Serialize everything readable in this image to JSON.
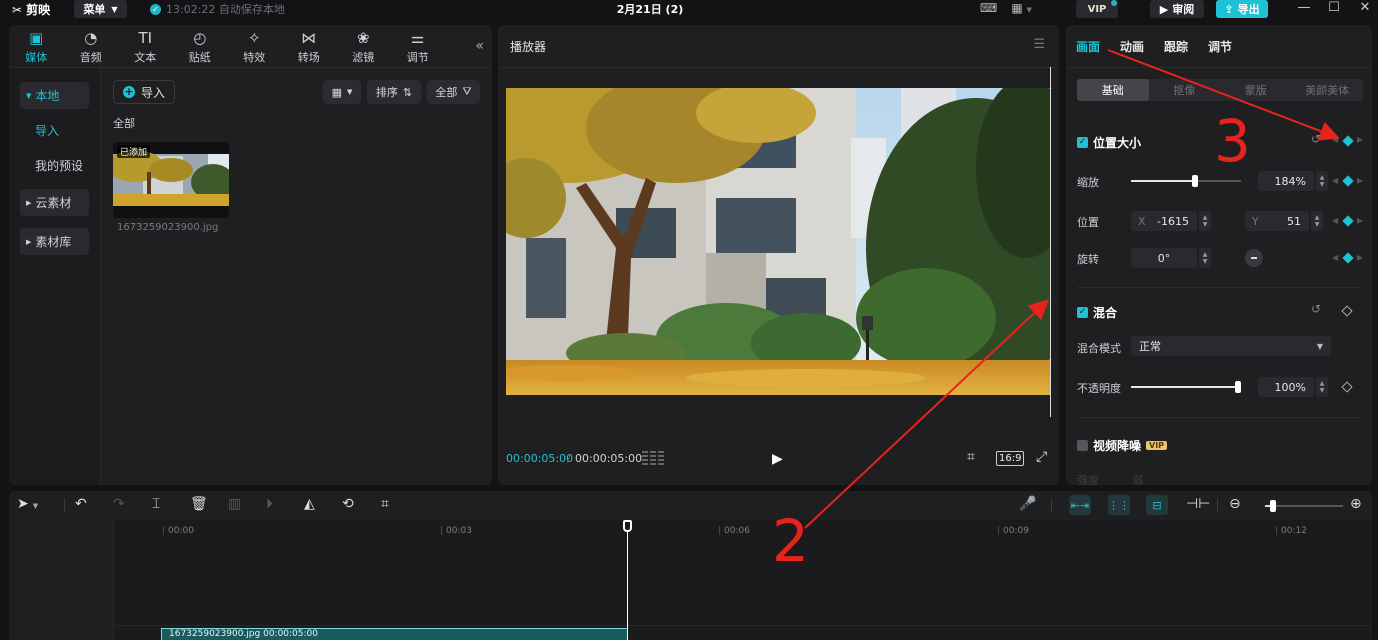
{
  "titlebar": {
    "app_name": "剪映",
    "menu_label": "菜单",
    "autosave_text": "13:02:22 自动保存本地",
    "doc_title": "2月21日 (2)",
    "vip_label": "VIP",
    "review_label": "审阅",
    "export_label": "导出"
  },
  "media": {
    "tabs": [
      {
        "label": "媒体",
        "icon": "media-icon"
      },
      {
        "label": "音频",
        "icon": "audio-icon"
      },
      {
        "label": "文本",
        "icon": "text-icon"
      },
      {
        "label": "贴纸",
        "icon": "sticker-icon"
      },
      {
        "label": "特效",
        "icon": "effects-icon"
      },
      {
        "label": "转场",
        "icon": "transition-icon"
      },
      {
        "label": "滤镜",
        "icon": "filter-icon"
      },
      {
        "label": "调节",
        "icon": "adjust-icon"
      }
    ],
    "sidebar": {
      "local": "本地",
      "import": "导入",
      "presets": "我的预设",
      "cloud": "云素材",
      "library": "素材库"
    },
    "import_label": "导入",
    "sort_label": "排序",
    "filter_label": "全部",
    "all_label": "全部",
    "clip": {
      "badge": "已添加",
      "filename": "1673259023900.jpg"
    }
  },
  "player": {
    "title": "播放器",
    "current_time": "00:00:05:00",
    "separator": "/",
    "total_time": "00:00:05:00",
    "ratio": "16:9"
  },
  "properties": {
    "tabs": [
      "画面",
      "动画",
      "跟踪",
      "调节"
    ],
    "segments": [
      "基础",
      "抠像",
      "蒙版",
      "美颜美体"
    ],
    "position_size": {
      "title": "位置大小",
      "scale_label": "缩放",
      "scale_value": "184%",
      "scale_level": 0.55,
      "position_label": "位置",
      "x_prefix": "X",
      "x_value": "-1615",
      "y_prefix": "Y",
      "y_value": "51",
      "rotate_label": "旋转",
      "rotate_value": "0°"
    },
    "blend": {
      "title": "混合",
      "mode_label": "混合模式",
      "mode_value": "正常",
      "opacity_label": "不透明度",
      "opacity_value": "100%",
      "opacity_level": 1.0
    },
    "denoise": {
      "title": "视频降噪",
      "badge": "VIP",
      "faded_label": "强度",
      "faded_value": "弱"
    }
  },
  "timeline": {
    "ruler": [
      "00:00",
      "00:03",
      "00:06",
      "00:09",
      "00:12"
    ],
    "clip_label": "1673259023900.jpg  00:00:05:00"
  },
  "annotations": {
    "label_2": "2",
    "label_3": "3",
    "color": "#e8231d"
  },
  "colors": {
    "accent": "#1fc2d4",
    "panel": "#1f1f22",
    "background": "#131316"
  }
}
